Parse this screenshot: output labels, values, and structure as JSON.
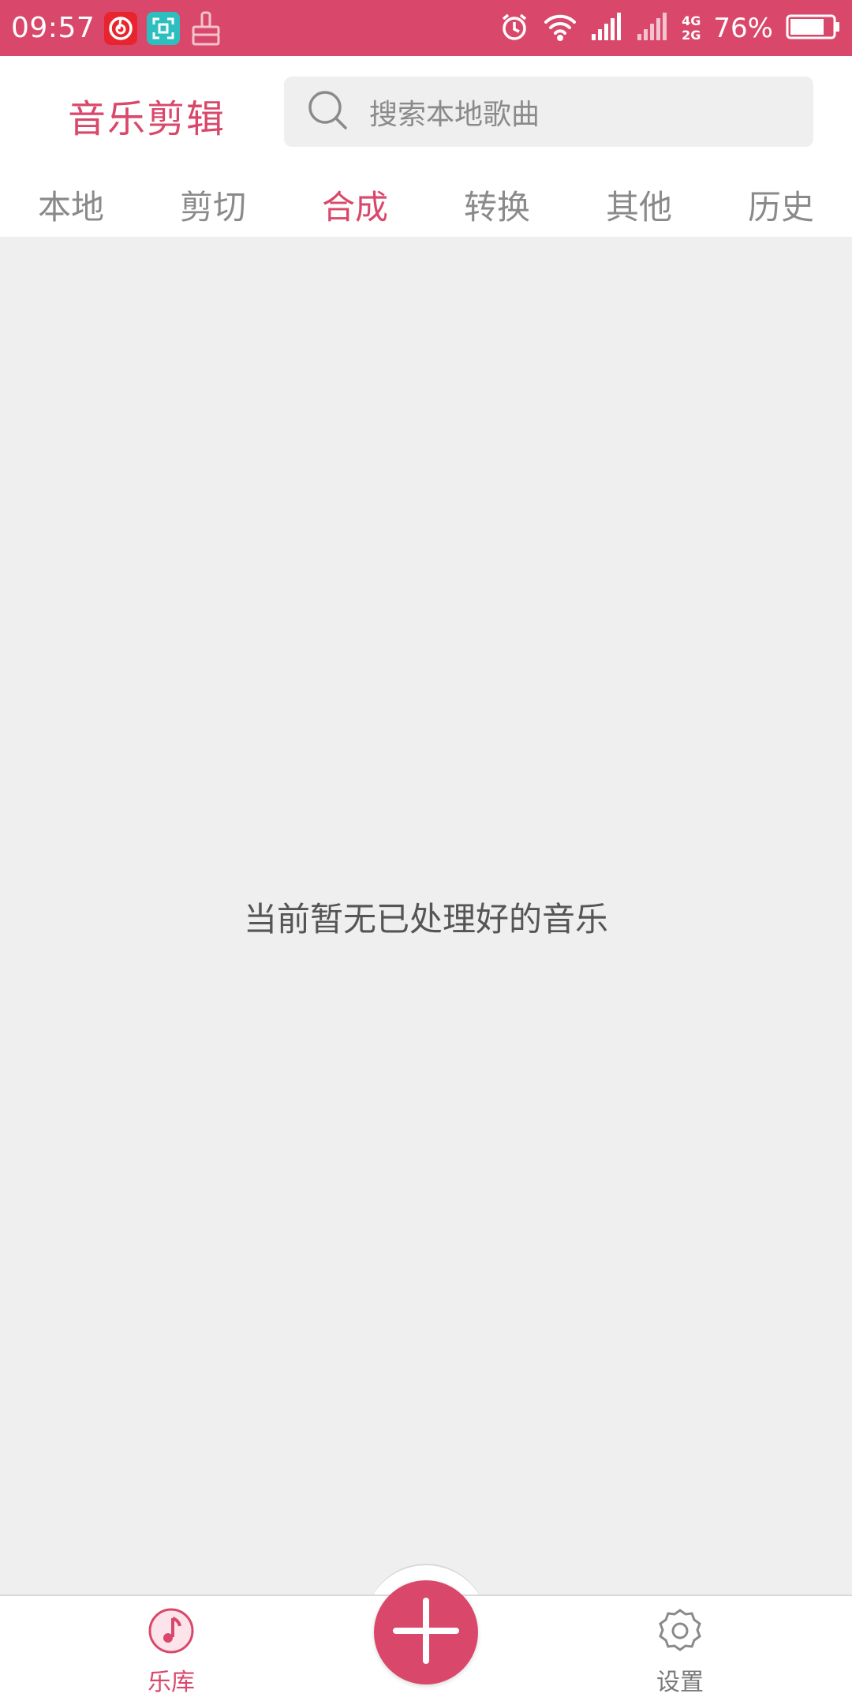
{
  "status_bar": {
    "time": "09:57",
    "network_top": "4G",
    "network_bottom": "2G",
    "battery": "76%",
    "icons": [
      "netease-music-icon",
      "scanner-icon",
      "cleaner-icon",
      "alarm-icon",
      "wifi-icon",
      "signal-icon",
      "signal-2-icon",
      "battery-icon"
    ]
  },
  "header": {
    "title": "音乐剪辑",
    "search": {
      "placeholder": "搜索本地歌曲",
      "icon": "search-icon"
    },
    "tabs": [
      {
        "label": "本地",
        "active": false
      },
      {
        "label": "剪切",
        "active": false
      },
      {
        "label": "合成",
        "active": true
      },
      {
        "label": "转换",
        "active": false
      },
      {
        "label": "其他",
        "active": false
      },
      {
        "label": "历史",
        "active": false
      }
    ]
  },
  "main": {
    "empty_message": "当前暂无已处理好的音乐"
  },
  "bottom_nav": {
    "library_label": "乐库",
    "library_icon": "music-note-icon",
    "add_icon": "plus-icon",
    "settings_label": "设置",
    "settings_icon": "gear-icon"
  },
  "colors": {
    "accent": "#d9486a",
    "background": "#efefef",
    "text_muted": "#8a8a8a"
  }
}
